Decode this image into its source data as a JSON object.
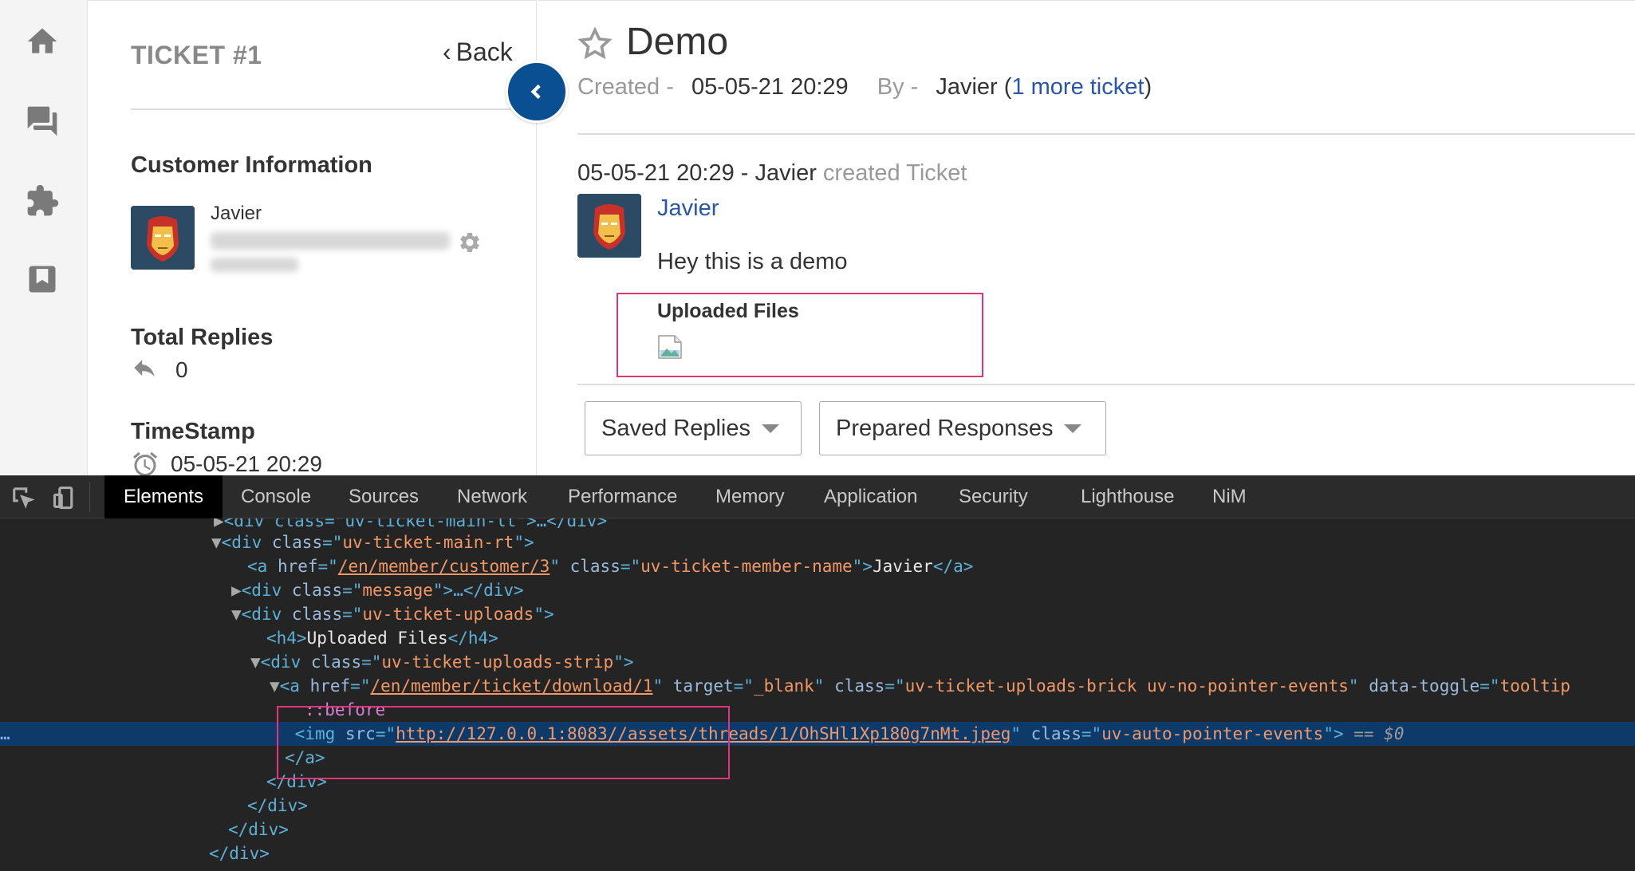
{
  "sidebar": {
    "ticket_label": "TICKET #1",
    "back_label": "Back",
    "customer_section_title": "Customer Information",
    "customer_name": "Javier",
    "total_replies_title": "Total Replies",
    "total_replies_value": "0",
    "timestamp_title": "TimeStamp",
    "timestamp_value": "05-05-21 20:29"
  },
  "ticket": {
    "subject": "Demo",
    "created_label": "Created -",
    "created_value": "05-05-21 20:29",
    "by_label": "By -",
    "by_name": "Javier",
    "more_tickets_link": "1 more ticket"
  },
  "thread": {
    "header_time": "05-05-21 20:29",
    "header_author": "Javier",
    "header_action": "created Ticket",
    "author_link": "Javier",
    "message": "Hey this is a demo",
    "uploads_title": "Uploaded Files"
  },
  "reply": {
    "saved_replies_label": "Saved Replies",
    "prepared_responses_label": "Prepared Responses"
  },
  "devtools": {
    "tabs": [
      "Elements",
      "Console",
      "Sources",
      "Network",
      "Performance",
      "Memory",
      "Application",
      "Security",
      "Lighthouse",
      "NiM"
    ],
    "active_tab": "Elements",
    "dom": {
      "l0": "<div class=\"uv-ticket-main-lt\">…</div>",
      "l1_class": "uv-ticket-main-rt",
      "l2_href": "/en/member/customer/3",
      "l2_class": "uv-ticket-member-name",
      "l2_text": "Javier",
      "l3_class": "message",
      "l4_class": "uv-ticket-uploads",
      "l5_text": "Uploaded Files",
      "l6_class": "uv-ticket-uploads-strip",
      "l7_href": "/en/member/ticket/download/1",
      "l7_target": "_blank",
      "l7_class": "uv-ticket-uploads-brick uv-no-pointer-events",
      "l7_toggle": "tooltip",
      "l8_pseudo": "::before",
      "l9_src": "http://127.0.0.1:8083//assets/threads/1/OhSHl1Xp180g7nMt.jpeg",
      "l9_class": "uv-auto-pointer-events",
      "l9_eq": "== $0"
    }
  },
  "colors": {
    "accent_blue": "#0a4f92",
    "link_blue": "#2a55a8",
    "highlight_pink": "#e1347f"
  },
  "icons": [
    "home-icon",
    "chat-icon",
    "puzzle-icon",
    "bookmark-icon",
    "settings-gear-icon",
    "reply-icon",
    "alarm-clock-icon",
    "star-outline-icon",
    "chevron-left-icon",
    "broken-image-icon",
    "inspect-element-icon",
    "device-toggle-icon"
  ]
}
